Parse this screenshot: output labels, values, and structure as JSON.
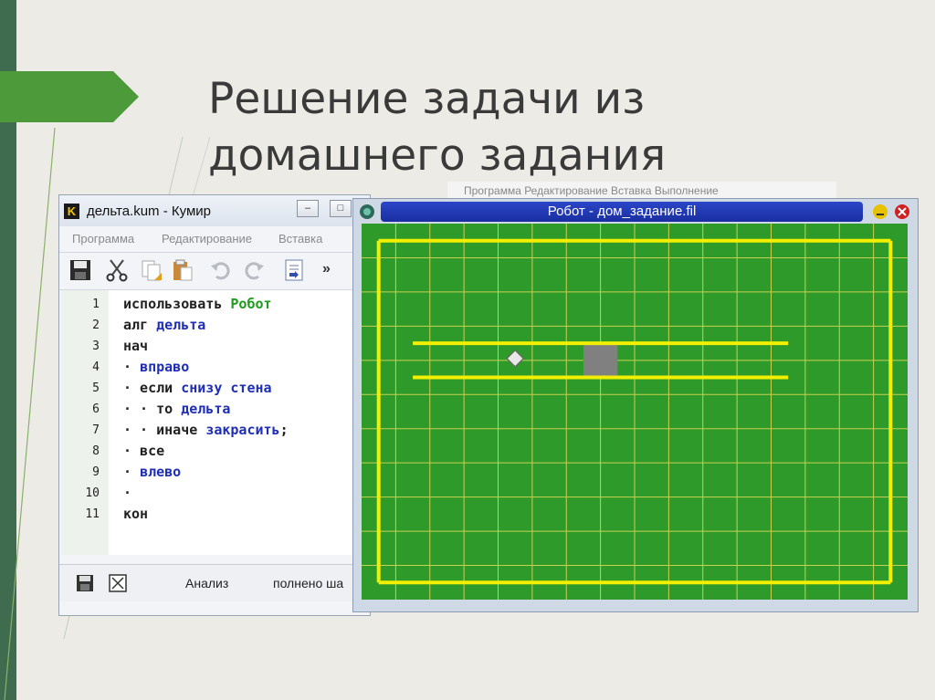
{
  "slide": {
    "title_line1": "Решение задачи из",
    "title_line2": "домашнего задания",
    "accent_color": "#4c9a3a",
    "stripe_color": "#3f6b4e"
  },
  "kumir": {
    "logo_letter": "K",
    "title": "дельта.kum - Кумир",
    "window_buttons": [
      "–",
      "□"
    ],
    "menu": [
      "Программа",
      "Редактирование",
      "Вставка"
    ],
    "toolbar_icons": [
      "save-icon",
      "cut-icon",
      "copy-icon",
      "paste-icon",
      "undo-icon",
      "redo-icon",
      "insert-icon",
      "more-icon"
    ],
    "toolbar_more": "»",
    "code_lines": [
      {
        "num": "1",
        "parts": [
          {
            "t": "использовать ",
            "c": "kw"
          },
          {
            "t": "Робот",
            "c": "gr"
          }
        ]
      },
      {
        "num": "2",
        "parts": [
          {
            "t": "алг ",
            "c": "kw"
          },
          {
            "t": "дельта",
            "c": "bl"
          }
        ]
      },
      {
        "num": "3",
        "parts": [
          {
            "t": "нач",
            "c": "kw"
          }
        ]
      },
      {
        "num": "4",
        "parts": [
          {
            "t": "· ",
            "c": "kw"
          },
          {
            "t": "вправо",
            "c": "bl"
          }
        ]
      },
      {
        "num": "5",
        "parts": [
          {
            "t": "· если ",
            "c": "kw"
          },
          {
            "t": "снизу стена",
            "c": "bl"
          }
        ]
      },
      {
        "num": "6",
        "parts": [
          {
            "t": "· · то ",
            "c": "kw"
          },
          {
            "t": "дельта",
            "c": "bl"
          }
        ]
      },
      {
        "num": "7",
        "parts": [
          {
            "t": "· · иначе ",
            "c": "kw"
          },
          {
            "t": "закрасить",
            "c": "bl"
          },
          {
            "t": ";",
            "c": "kw"
          }
        ]
      },
      {
        "num": "8",
        "parts": [
          {
            "t": "· все",
            "c": "kw"
          }
        ]
      },
      {
        "num": "9",
        "parts": [
          {
            "t": "· ",
            "c": "kw"
          },
          {
            "t": "влево",
            "c": "bl"
          }
        ]
      },
      {
        "num": "10",
        "parts": [
          {
            "t": "·",
            "c": "kw"
          }
        ]
      },
      {
        "num": "11",
        "parts": [
          {
            "t": "кон",
            "c": "kw"
          }
        ]
      }
    ],
    "status": {
      "analiz": "Анализ",
      "done": "полнено ша"
    }
  },
  "background_window": {
    "menu_text": "Программа   Редактирование   Вставка   Выполнение"
  },
  "robot": {
    "title": "Робот - дом_задание.fil",
    "field_color": "#2e9a2a",
    "grid_color": "#c8d050",
    "wall_color": "#f2f000",
    "painted_color": "#808080",
    "cols": 16,
    "rows": 11,
    "walls": [
      {
        "from": [
          0.5,
          0.5
        ],
        "to": [
          15.5,
          0.5
        ]
      },
      {
        "from": [
          15.5,
          0.5
        ],
        "to": [
          15.5,
          10.5
        ]
      },
      {
        "from": [
          15.5,
          10.5
        ],
        "to": [
          0.5,
          10.5
        ]
      },
      {
        "from": [
          0.5,
          10.5
        ],
        "to": [
          0.5,
          0.5
        ]
      },
      {
        "from": [
          1.5,
          3.5
        ],
        "to": [
          12.5,
          3.5
        ]
      },
      {
        "from": [
          1.5,
          4.5
        ],
        "to": [
          12.5,
          4.5
        ]
      }
    ],
    "painted_cells": [
      [
        6.5,
        3.5
      ]
    ],
    "robot_cell": [
      4,
      3.5
    ]
  }
}
